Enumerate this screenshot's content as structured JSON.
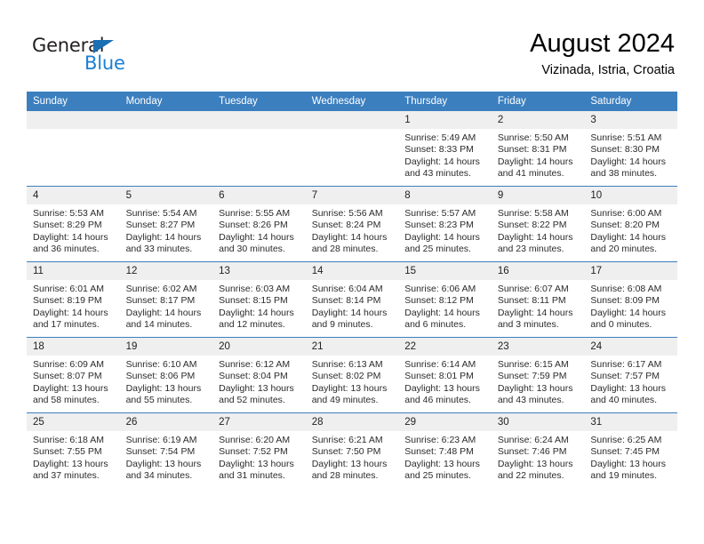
{
  "logo": {
    "name_part1": "General",
    "name_part2": "Blue",
    "triangle_color": "#1b6fb3",
    "blue_color": "#1b7fd4"
  },
  "header": {
    "title": "August 2024",
    "subtitle": "Vizinada, Istria, Croatia"
  },
  "theme": {
    "header_bg": "#3c7fbf",
    "daynum_bg": "#efefef",
    "grid_line": "#3c7fbf"
  },
  "weekday_headers": [
    "Sunday",
    "Monday",
    "Tuesday",
    "Wednesday",
    "Thursday",
    "Friday",
    "Saturday"
  ],
  "weeks": [
    [
      {
        "day": "",
        "sunrise": "",
        "sunset": "",
        "daylight_1": "",
        "daylight_2": ""
      },
      {
        "day": "",
        "sunrise": "",
        "sunset": "",
        "daylight_1": "",
        "daylight_2": ""
      },
      {
        "day": "",
        "sunrise": "",
        "sunset": "",
        "daylight_1": "",
        "daylight_2": ""
      },
      {
        "day": "",
        "sunrise": "",
        "sunset": "",
        "daylight_1": "",
        "daylight_2": ""
      },
      {
        "day": "1",
        "sunrise": "Sunrise: 5:49 AM",
        "sunset": "Sunset: 8:33 PM",
        "daylight_1": "Daylight: 14 hours",
        "daylight_2": "and 43 minutes."
      },
      {
        "day": "2",
        "sunrise": "Sunrise: 5:50 AM",
        "sunset": "Sunset: 8:31 PM",
        "daylight_1": "Daylight: 14 hours",
        "daylight_2": "and 41 minutes."
      },
      {
        "day": "3",
        "sunrise": "Sunrise: 5:51 AM",
        "sunset": "Sunset: 8:30 PM",
        "daylight_1": "Daylight: 14 hours",
        "daylight_2": "and 38 minutes."
      }
    ],
    [
      {
        "day": "4",
        "sunrise": "Sunrise: 5:53 AM",
        "sunset": "Sunset: 8:29 PM",
        "daylight_1": "Daylight: 14 hours",
        "daylight_2": "and 36 minutes."
      },
      {
        "day": "5",
        "sunrise": "Sunrise: 5:54 AM",
        "sunset": "Sunset: 8:27 PM",
        "daylight_1": "Daylight: 14 hours",
        "daylight_2": "and 33 minutes."
      },
      {
        "day": "6",
        "sunrise": "Sunrise: 5:55 AM",
        "sunset": "Sunset: 8:26 PM",
        "daylight_1": "Daylight: 14 hours",
        "daylight_2": "and 30 minutes."
      },
      {
        "day": "7",
        "sunrise": "Sunrise: 5:56 AM",
        "sunset": "Sunset: 8:24 PM",
        "daylight_1": "Daylight: 14 hours",
        "daylight_2": "and 28 minutes."
      },
      {
        "day": "8",
        "sunrise": "Sunrise: 5:57 AM",
        "sunset": "Sunset: 8:23 PM",
        "daylight_1": "Daylight: 14 hours",
        "daylight_2": "and 25 minutes."
      },
      {
        "day": "9",
        "sunrise": "Sunrise: 5:58 AM",
        "sunset": "Sunset: 8:22 PM",
        "daylight_1": "Daylight: 14 hours",
        "daylight_2": "and 23 minutes."
      },
      {
        "day": "10",
        "sunrise": "Sunrise: 6:00 AM",
        "sunset": "Sunset: 8:20 PM",
        "daylight_1": "Daylight: 14 hours",
        "daylight_2": "and 20 minutes."
      }
    ],
    [
      {
        "day": "11",
        "sunrise": "Sunrise: 6:01 AM",
        "sunset": "Sunset: 8:19 PM",
        "daylight_1": "Daylight: 14 hours",
        "daylight_2": "and 17 minutes."
      },
      {
        "day": "12",
        "sunrise": "Sunrise: 6:02 AM",
        "sunset": "Sunset: 8:17 PM",
        "daylight_1": "Daylight: 14 hours",
        "daylight_2": "and 14 minutes."
      },
      {
        "day": "13",
        "sunrise": "Sunrise: 6:03 AM",
        "sunset": "Sunset: 8:15 PM",
        "daylight_1": "Daylight: 14 hours",
        "daylight_2": "and 12 minutes."
      },
      {
        "day": "14",
        "sunrise": "Sunrise: 6:04 AM",
        "sunset": "Sunset: 8:14 PM",
        "daylight_1": "Daylight: 14 hours",
        "daylight_2": "and 9 minutes."
      },
      {
        "day": "15",
        "sunrise": "Sunrise: 6:06 AM",
        "sunset": "Sunset: 8:12 PM",
        "daylight_1": "Daylight: 14 hours",
        "daylight_2": "and 6 minutes."
      },
      {
        "day": "16",
        "sunrise": "Sunrise: 6:07 AM",
        "sunset": "Sunset: 8:11 PM",
        "daylight_1": "Daylight: 14 hours",
        "daylight_2": "and 3 minutes."
      },
      {
        "day": "17",
        "sunrise": "Sunrise: 6:08 AM",
        "sunset": "Sunset: 8:09 PM",
        "daylight_1": "Daylight: 14 hours",
        "daylight_2": "and 0 minutes."
      }
    ],
    [
      {
        "day": "18",
        "sunrise": "Sunrise: 6:09 AM",
        "sunset": "Sunset: 8:07 PM",
        "daylight_1": "Daylight: 13 hours",
        "daylight_2": "and 58 minutes."
      },
      {
        "day": "19",
        "sunrise": "Sunrise: 6:10 AM",
        "sunset": "Sunset: 8:06 PM",
        "daylight_1": "Daylight: 13 hours",
        "daylight_2": "and 55 minutes."
      },
      {
        "day": "20",
        "sunrise": "Sunrise: 6:12 AM",
        "sunset": "Sunset: 8:04 PM",
        "daylight_1": "Daylight: 13 hours",
        "daylight_2": "and 52 minutes."
      },
      {
        "day": "21",
        "sunrise": "Sunrise: 6:13 AM",
        "sunset": "Sunset: 8:02 PM",
        "daylight_1": "Daylight: 13 hours",
        "daylight_2": "and 49 minutes."
      },
      {
        "day": "22",
        "sunrise": "Sunrise: 6:14 AM",
        "sunset": "Sunset: 8:01 PM",
        "daylight_1": "Daylight: 13 hours",
        "daylight_2": "and 46 minutes."
      },
      {
        "day": "23",
        "sunrise": "Sunrise: 6:15 AM",
        "sunset": "Sunset: 7:59 PM",
        "daylight_1": "Daylight: 13 hours",
        "daylight_2": "and 43 minutes."
      },
      {
        "day": "24",
        "sunrise": "Sunrise: 6:17 AM",
        "sunset": "Sunset: 7:57 PM",
        "daylight_1": "Daylight: 13 hours",
        "daylight_2": "and 40 minutes."
      }
    ],
    [
      {
        "day": "25",
        "sunrise": "Sunrise: 6:18 AM",
        "sunset": "Sunset: 7:55 PM",
        "daylight_1": "Daylight: 13 hours",
        "daylight_2": "and 37 minutes."
      },
      {
        "day": "26",
        "sunrise": "Sunrise: 6:19 AM",
        "sunset": "Sunset: 7:54 PM",
        "daylight_1": "Daylight: 13 hours",
        "daylight_2": "and 34 minutes."
      },
      {
        "day": "27",
        "sunrise": "Sunrise: 6:20 AM",
        "sunset": "Sunset: 7:52 PM",
        "daylight_1": "Daylight: 13 hours",
        "daylight_2": "and 31 minutes."
      },
      {
        "day": "28",
        "sunrise": "Sunrise: 6:21 AM",
        "sunset": "Sunset: 7:50 PM",
        "daylight_1": "Daylight: 13 hours",
        "daylight_2": "and 28 minutes."
      },
      {
        "day": "29",
        "sunrise": "Sunrise: 6:23 AM",
        "sunset": "Sunset: 7:48 PM",
        "daylight_1": "Daylight: 13 hours",
        "daylight_2": "and 25 minutes."
      },
      {
        "day": "30",
        "sunrise": "Sunrise: 6:24 AM",
        "sunset": "Sunset: 7:46 PM",
        "daylight_1": "Daylight: 13 hours",
        "daylight_2": "and 22 minutes."
      },
      {
        "day": "31",
        "sunrise": "Sunrise: 6:25 AM",
        "sunset": "Sunset: 7:45 PM",
        "daylight_1": "Daylight: 13 hours",
        "daylight_2": "and 19 minutes."
      }
    ]
  ]
}
